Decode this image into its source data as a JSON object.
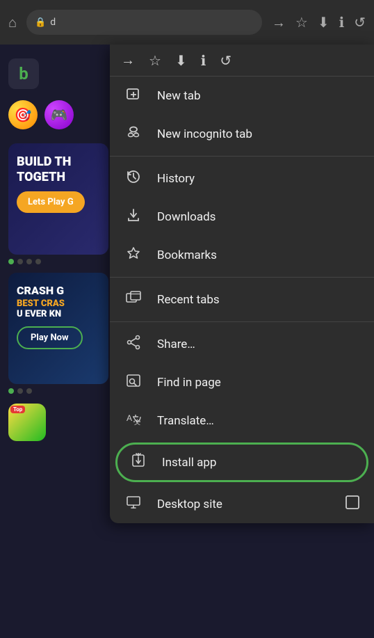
{
  "browser": {
    "url": "d",
    "lock_icon": "🔒"
  },
  "sidebar": {
    "logo_letter": "b",
    "menu_icon": "☰",
    "banner1": {
      "title_line1": "BUILD TH",
      "title_line2": "TOGETH",
      "button_label": "Lets Play G"
    },
    "dots": [
      {
        "active": true
      },
      {
        "active": false
      },
      {
        "active": false
      },
      {
        "active": false
      }
    ],
    "banner2": {
      "title": "CRASH G",
      "subtitle_line1": "BEST CRAS",
      "subtitle_line2": "U EVER KN",
      "button_label": "Play Now"
    },
    "dots2": [
      {
        "active": true
      },
      {
        "active": false
      },
      {
        "active": false
      }
    ],
    "game_thumb_badge": "Top"
  },
  "dropdown": {
    "top_icons": [
      "→",
      "☆",
      "⬇",
      "ℹ",
      "↺"
    ],
    "items": [
      {
        "id": "new-tab",
        "icon": "new_tab",
        "label": "New tab",
        "divider_after": false
      },
      {
        "id": "new-incognito-tab",
        "icon": "incognito",
        "label": "New incognito tab",
        "divider_after": true
      },
      {
        "id": "history",
        "icon": "history",
        "label": "History",
        "divider_after": false
      },
      {
        "id": "downloads",
        "icon": "downloads",
        "label": "Downloads",
        "divider_after": false
      },
      {
        "id": "bookmarks",
        "icon": "bookmarks",
        "label": "Bookmarks",
        "divider_after": true
      },
      {
        "id": "recent-tabs",
        "icon": "recent_tabs",
        "label": "Recent tabs",
        "divider_after": true
      },
      {
        "id": "share",
        "icon": "share",
        "label": "Share…",
        "divider_after": false
      },
      {
        "id": "find-in-page",
        "icon": "find",
        "label": "Find in page",
        "divider_after": false
      },
      {
        "id": "translate",
        "icon": "translate",
        "label": "Translate…",
        "divider_after": false
      },
      {
        "id": "install-app",
        "icon": "install",
        "label": "Install app",
        "highlighted": true,
        "divider_after": false
      },
      {
        "id": "desktop-site",
        "icon": "desktop",
        "label": "Desktop site",
        "has_checkbox": true,
        "divider_after": false
      }
    ]
  },
  "colors": {
    "accent_green": "#4caf50",
    "menu_bg": "#2d2d2d",
    "text_primary": "#f0f0f0",
    "text_secondary": "#cccccc"
  }
}
